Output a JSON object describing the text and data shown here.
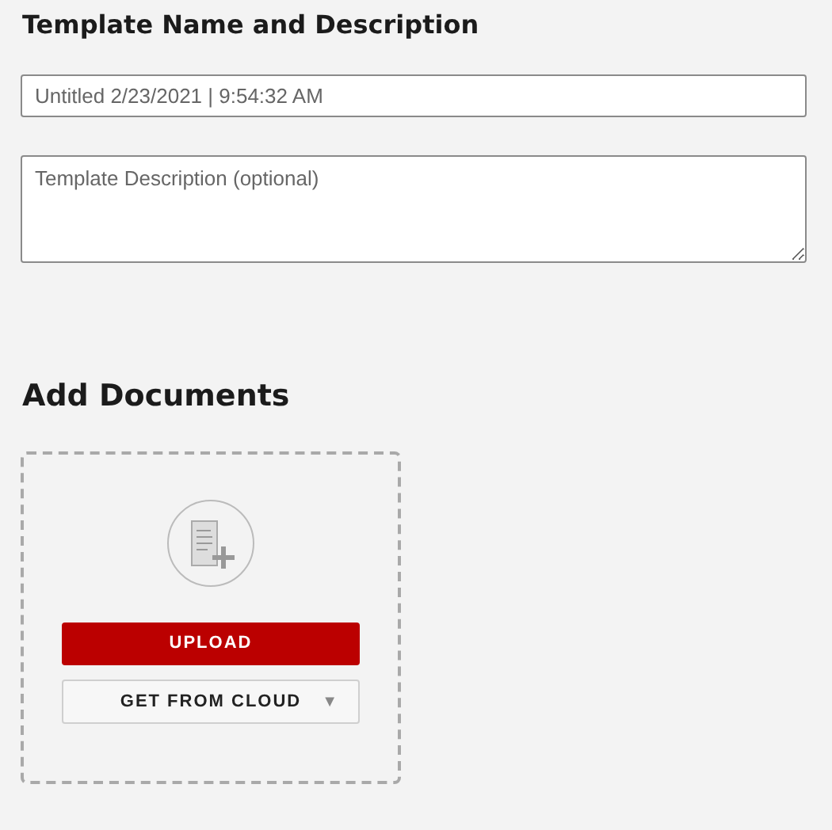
{
  "template_section": {
    "heading": "Template Name and Description",
    "name_field": {
      "value": "Untitled 2/23/2021 | 9:54:32 AM"
    },
    "description_field": {
      "placeholder": "Template Description (optional)"
    }
  },
  "documents_section": {
    "heading": "Add Documents",
    "upload_button": "UPLOAD",
    "cloud_button": {
      "label": "GET FROM CLOUD",
      "caret": "▼"
    }
  }
}
